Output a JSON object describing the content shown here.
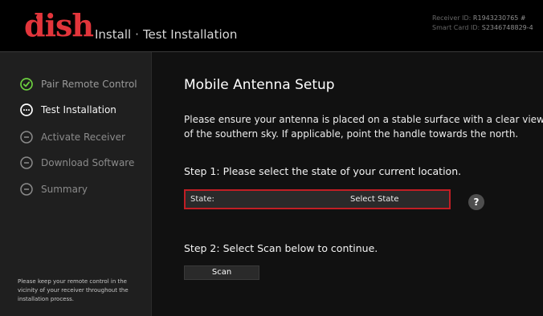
{
  "brand": {
    "logo": "dish"
  },
  "header": {
    "section": "Install",
    "separator": "·",
    "page": "Test Installation",
    "receiver_label": "Receiver ID:",
    "receiver_value": "R1943230765 #",
    "smartcard_label": "Smart Card ID:",
    "smartcard_value": "S2346748829-4"
  },
  "sidebar": {
    "steps": [
      {
        "label": "Pair Remote Control",
        "state": "done",
        "icon": "check-circle-icon"
      },
      {
        "label": "Test Installation",
        "state": "active",
        "icon": "ellipsis-circle-icon"
      },
      {
        "label": "Activate Receiver",
        "state": "pending",
        "icon": "minus-circle-icon"
      },
      {
        "label": "Download Software",
        "state": "pending",
        "icon": "minus-circle-icon"
      },
      {
        "label": "Summary",
        "state": "pending",
        "icon": "minus-circle-icon"
      }
    ],
    "note": "Please keep your remote control in the vicinity of your receiver throughout the installation process."
  },
  "main": {
    "title": "Mobile Antenna Setup",
    "description": "Please ensure your antenna is placed on a stable surface with a clear view of the southern sky. If applicable, point the handle towards the north.",
    "step1": "Step 1: Please select the state of your current location.",
    "state_field_label": "State:",
    "state_field_value": "Select State",
    "help_icon_text": "?",
    "step2": "Step 2: Select Scan below to continue.",
    "scan_label": "Scan"
  },
  "colors": {
    "brand_red": "#e2353b",
    "header_bg": "#000000",
    "sidebar_bg": "#1f1f1f",
    "main_bg": "#111111",
    "select_border": "#c11e24"
  }
}
